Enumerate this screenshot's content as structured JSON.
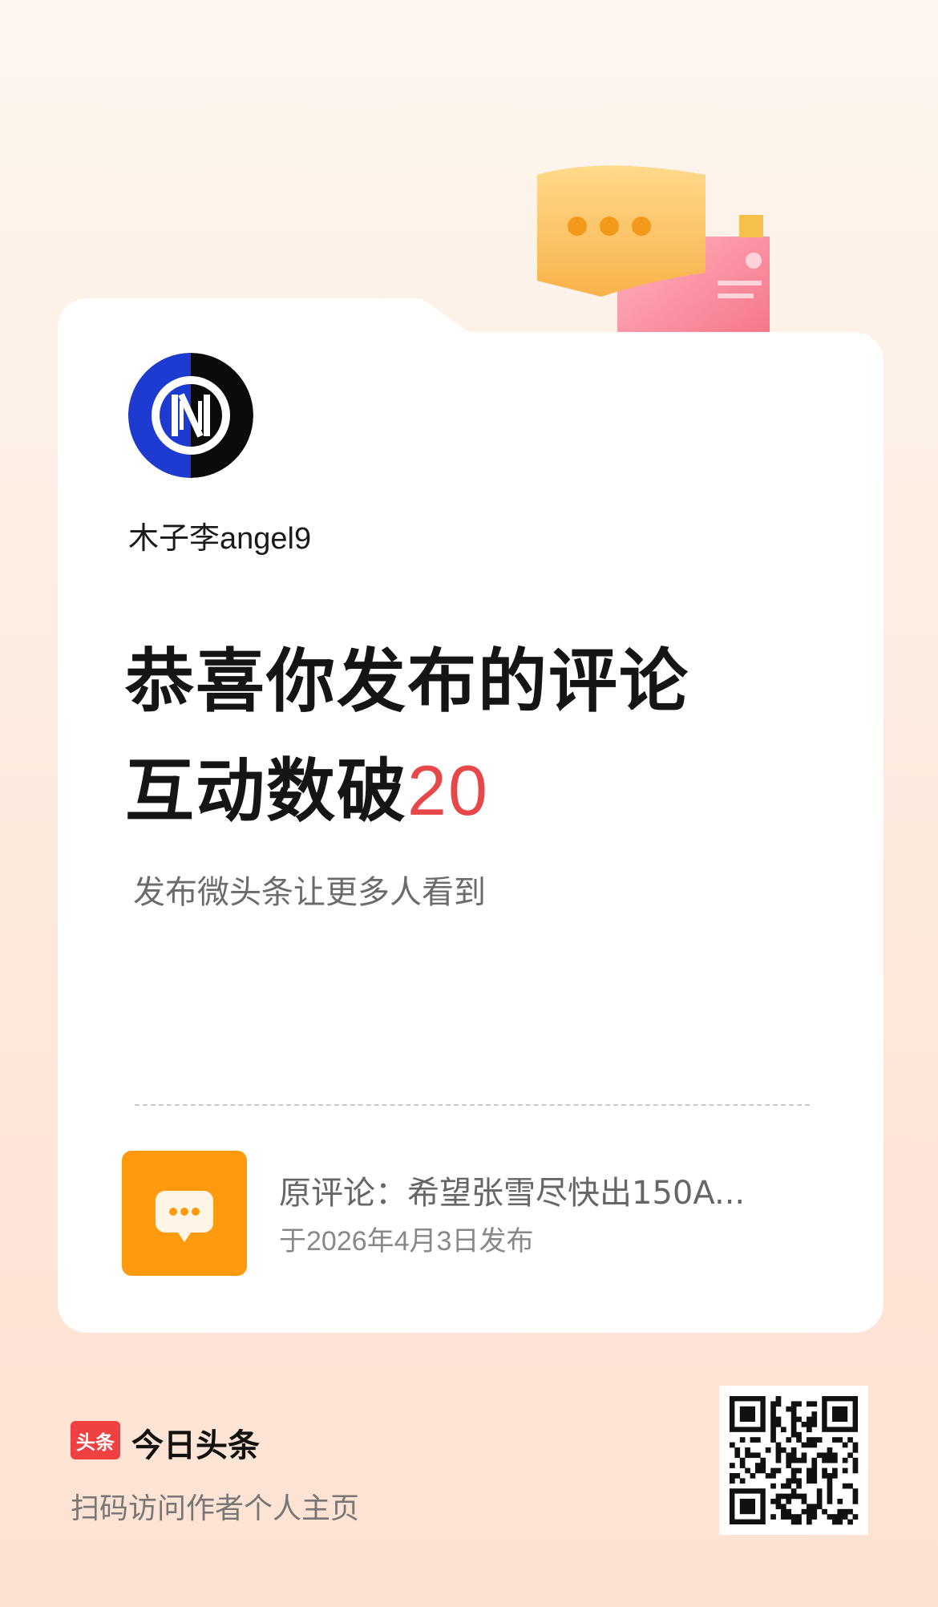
{
  "card": {
    "username": "木子李angel9",
    "headline_line1": "恭喜你发布的评论",
    "headline_line2_prefix": "互动数破",
    "headline_number": "20",
    "subline": "发布微头条让更多人看到",
    "comment": {
      "text": "原评论：希望张雪尽快出150A...",
      "date": "于2026年4月3日发布"
    }
  },
  "footer": {
    "logo_text": "头条",
    "brand_name": "今日头条",
    "caption": "扫码访问作者个人主页"
  },
  "colors": {
    "accent_number": "#e8474a",
    "comment_icon_bg": "#ff9a0e",
    "brand_red": "#f04142"
  },
  "icons": {
    "avatar": "inter-milan-logo",
    "decoration": "chat-bubble-flag-illustration",
    "comment": "chat-bubble-icon",
    "qr": "qr-code"
  }
}
